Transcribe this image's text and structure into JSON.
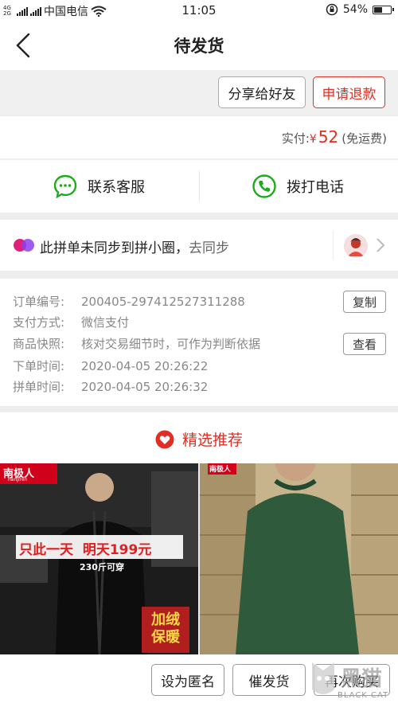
{
  "status_bar": {
    "network_top": "4G",
    "network_bottom": "2G",
    "carrier": "中国电信",
    "time": "11:05",
    "battery_percent": "54%",
    "battery_level": 0.54
  },
  "nav": {
    "title": "待发货",
    "back_icon": "chevron-left-icon"
  },
  "actions": {
    "share": "分享给好友",
    "refund": "申请退款"
  },
  "payment": {
    "label": "实付:",
    "currency": "¥",
    "amount": "52",
    "shipping": "(免运费)"
  },
  "contact": {
    "service": "联系客服",
    "call": "拨打电话"
  },
  "sync": {
    "text": "此拼单未同步到拼小圈，",
    "link": "去同步"
  },
  "order": {
    "rows": [
      {
        "label": "订单编号:",
        "value": "200405-297412527311288"
      },
      {
        "label": "支付方式:",
        "value": "微信支付"
      },
      {
        "label": "商品快照:",
        "value": "核对交易细节时，可作为判断依据"
      },
      {
        "label": "下单时间:",
        "value": "2020-04-05 20:26:22"
      },
      {
        "label": "拼单时间:",
        "value": "2020-04-05 20:26:32"
      }
    ],
    "copy_btn": "复制",
    "view_btn": "查看"
  },
  "recommend": {
    "title": "精选推荐"
  },
  "products": [
    {
      "brand": "南极人",
      "brand_sub": "nanjiren",
      "promo": "只此一天  明天199元",
      "promo_sub": "230斤可穿",
      "badge_line1": "加绒",
      "badge_line2": "保暖"
    },
    {
      "brand": "南极人"
    }
  ],
  "bottom": {
    "anonymous": "设为匿名",
    "urge": "催发货",
    "rebuy": "再次购买"
  },
  "watermark": {
    "brand": "黑猫",
    "sub": "BLACK CAT"
  },
  "colors": {
    "accent": "#e02e24",
    "wechat_green": "#1aad19"
  }
}
